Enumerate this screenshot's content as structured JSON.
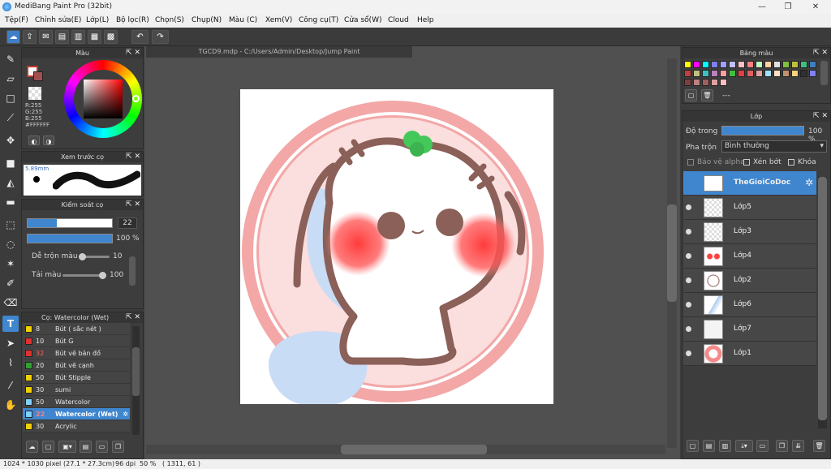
{
  "app": {
    "title": "MediBang Paint Pro (32bit)"
  },
  "menu": [
    "Tệp(F)",
    "Chỉnh sửa(E)",
    "Lớp(L)",
    "Bộ lọc(R)",
    "Chọn(S)",
    "Chụp(N)",
    "Màu (C)",
    "Xem(V)",
    "Công cụ(T)",
    "Cửa sổ(W)",
    "Cloud",
    "Help"
  ],
  "document": {
    "tab": "TGCD9.mdp - C:/Users/Admin/Desktop/Jump Paint"
  },
  "color_panel": {
    "title": "Màu",
    "r": "R:255",
    "g": "G:255",
    "b": "B:255",
    "hex": "#FFFFFF"
  },
  "brush_preview": {
    "title": "Xem trước cọ",
    "size": "5.89mm"
  },
  "brush_control": {
    "title": "Kiểm soát cọ",
    "size": "22",
    "opacity": "100 %",
    "blend_label": "Dễ trộn màu",
    "blend_value": "10",
    "reload_label": "Tải màu",
    "reload_value": "100",
    "size_level": 0.35,
    "opacity_level": 1.0
  },
  "brush_list": {
    "title": "Cọ: Watercolor (Wet)",
    "items": [
      {
        "size": "8",
        "name": "Bút ( sắc nét )",
        "color": "#f0d000"
      },
      {
        "size": "10",
        "name": "Bút G",
        "color": "#e03030"
      },
      {
        "size": "32",
        "name": "Bút vẽ bản đồ",
        "color": "#e03030"
      },
      {
        "size": "20",
        "name": "Bút vẽ cạnh",
        "color": "#30a030"
      },
      {
        "size": "50",
        "name": "Bút Stipple",
        "color": "#f0d000"
      },
      {
        "size": "30",
        "name": "sumi",
        "color": "#f0d000"
      },
      {
        "size": "50",
        "name": "Watercolor",
        "color": "#7fd0ff"
      },
      {
        "size": "22",
        "name": "Watercolor (Wet)",
        "color": "#7fd0ff",
        "selected": true
      },
      {
        "size": "30",
        "name": "Acrylic",
        "color": "#f0d000"
      }
    ]
  },
  "palette": {
    "title": "Bảng màu",
    "none": "---",
    "colors": [
      "#ffff00",
      "#ff00ff",
      "#00ffff",
      "#7f7fff",
      "#a0a0ff",
      "#c0c0ff",
      "#ffc0c0",
      "#ff8080",
      "#c0ffc0",
      "#ffd0a0",
      "#e0e0e0",
      "#7fbf3f",
      "#bfbf3f",
      "#3fbf7f",
      "#3f7fbf",
      "#bf3f3f",
      "#bfbf7f",
      "#3fbfbf",
      "#bf7fbf",
      "#ffa0a0",
      "#3fbf3f",
      "#e04040",
      "#e06060",
      "#e0a0a0",
      "#a0e0ff",
      "#ffe0c0",
      "#c09070",
      "#ffd080",
      "#303030",
      "#8080ff",
      "#7f3f3f",
      "#bf7f7f",
      "#9f5f5f",
      "#df9f9f",
      "#ffbfbf"
    ]
  },
  "layers_panel": {
    "title": "Lớp",
    "opacity_label": "Độ trong",
    "opacity_value": "100 %",
    "blend_label": "Pha trộn",
    "blend_value": "Bình thường",
    "protect_alpha": "Bảo vệ alpha",
    "clip": "Xén bớt",
    "lock": "Khóa",
    "layers": [
      {
        "name": "TheGioiCoDoc",
        "selected": true
      },
      {
        "name": "Lớp5"
      },
      {
        "name": "Lớp3"
      },
      {
        "name": "Lớp4"
      },
      {
        "name": "Lớp2"
      },
      {
        "name": "Lớp6"
      },
      {
        "name": "Lớp7"
      },
      {
        "name": "Lớp1"
      }
    ]
  },
  "status": {
    "size": "1024 * 1030 pixel",
    "cm": "(27.1 * 27.3cm)",
    "dpi": "96 dpi",
    "zoom": "50 %",
    "coords": "( 1311, 61 )"
  },
  "colors": {
    "accent": "#3f86cf",
    "panel": "#3d3d3d",
    "canvas_bg": "#505050"
  }
}
